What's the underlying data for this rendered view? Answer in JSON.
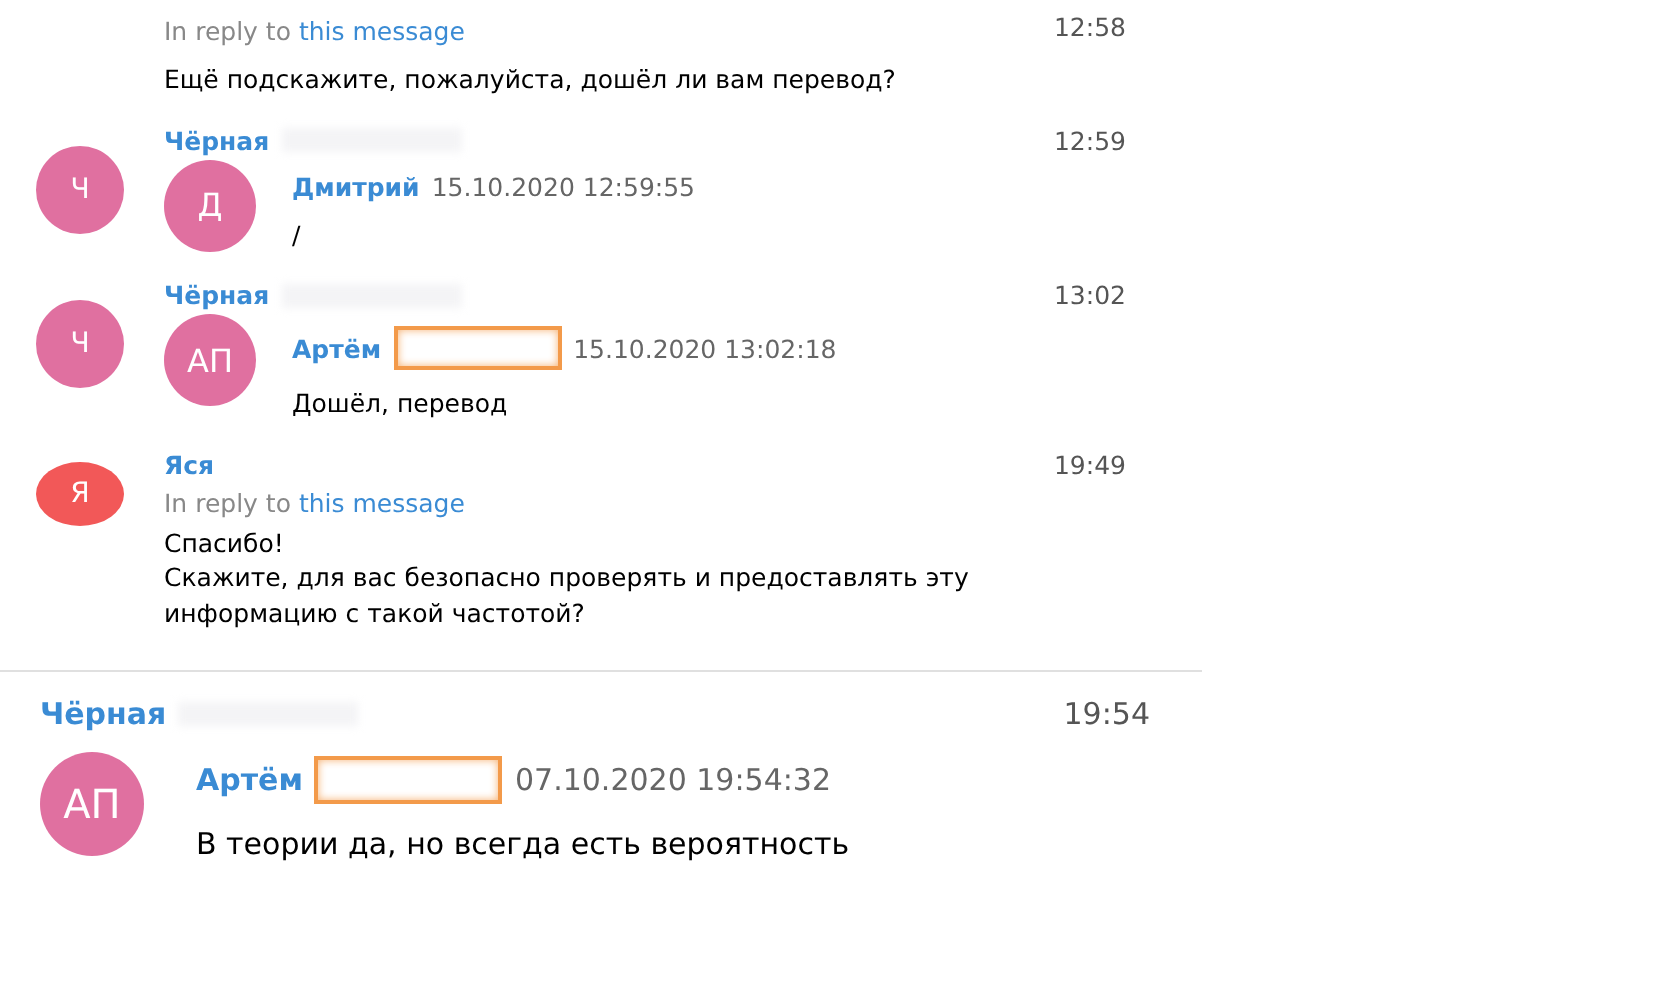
{
  "panels": [
    {
      "messages": [
        {
          "kind": "continuation",
          "time": "12:58",
          "reply": {
            "prefix": "In reply to",
            "link": "this message"
          },
          "lines": [
            "Ещё подскажите, пожалуйста, дошёл ли вам перевод?"
          ]
        },
        {
          "kind": "forwarded",
          "avatar": "Ч",
          "color": "#e070a0",
          "author": "Чёрная",
          "author_redacted": true,
          "time": "12:59",
          "forward": {
            "avatar": "Д",
            "color": "#e070a0",
            "name": "Дмитрий",
            "name_redacted": false,
            "date": "15.10.2020 12:59:55",
            "lines": [
              "/"
            ]
          }
        },
        {
          "kind": "forwarded",
          "avatar": "Ч",
          "color": "#e070a0",
          "author": "Чёрная",
          "author_redacted": true,
          "time": "13:02",
          "forward": {
            "avatar": "АП",
            "color": "#e070a0",
            "name": "Артём",
            "name_redacted": true,
            "date": "15.10.2020 13:02:18",
            "lines": [
              "Дошёл, перевод"
            ]
          }
        },
        {
          "kind": "message",
          "avatar": "Я",
          "color": "#f25858",
          "author": "Яся",
          "author_redacted": false,
          "time": "19:49",
          "reply": {
            "prefix": "In reply to",
            "link": "this message"
          },
          "lines": [
            "Спасибо!",
            "Скажите, для вас безопасно проверять и предоставлять эту",
            "информацию с такой частотой?"
          ]
        }
      ]
    },
    {
      "messages": [
        {
          "kind": "forwarded-no-avatar",
          "author": "Чёрная",
          "author_redacted": true,
          "time": "19:54",
          "forward": {
            "avatar": "АП",
            "color": "#e070a0",
            "name": "Артём",
            "name_redacted": true,
            "date": "07.10.2020 19:54:32",
            "lines": [
              "В теории да, но всегда есть вероятность"
            ]
          }
        }
      ]
    }
  ]
}
